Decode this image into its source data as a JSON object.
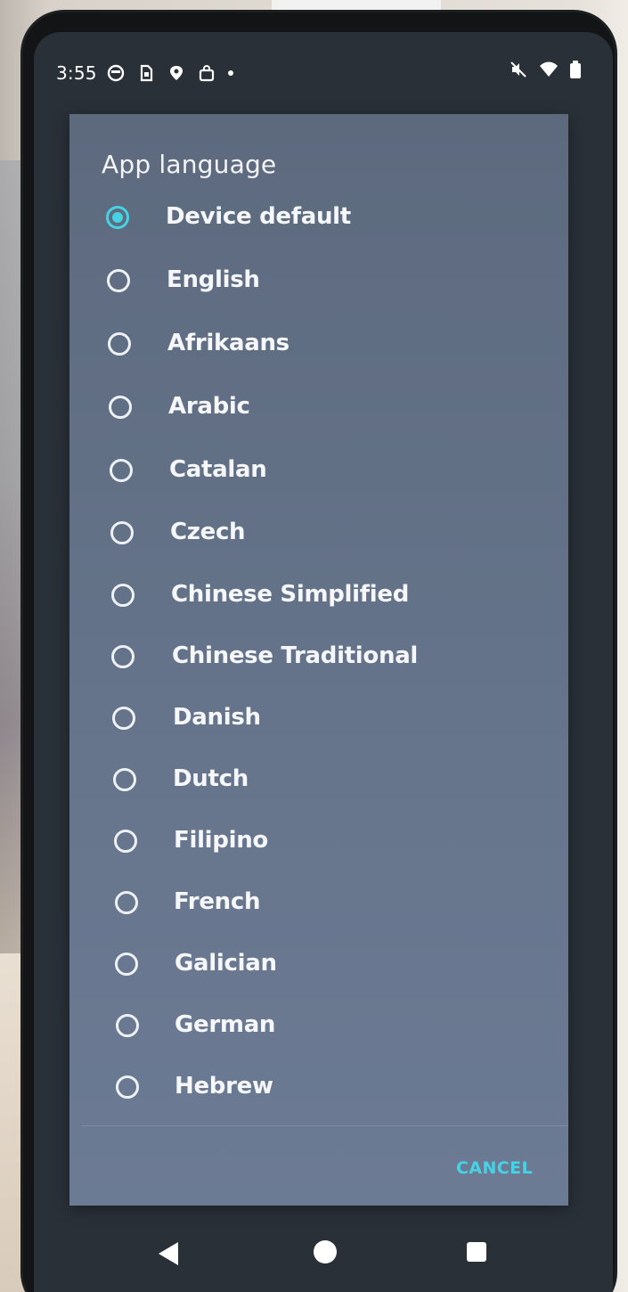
{
  "status_bar": {
    "time": "3:55",
    "left_icons": [
      "circle-face-icon",
      "sim-card-icon",
      "location-pin-icon",
      "shopping-bag-icon"
    ],
    "right_icons": [
      "mute-vibrate-icon",
      "wifi-icon",
      "battery-icon"
    ]
  },
  "dialog": {
    "title": "App language",
    "options": [
      {
        "label": "Device default",
        "selected": true
      },
      {
        "label": "English",
        "selected": false
      },
      {
        "label": "Afrikaans",
        "selected": false
      },
      {
        "label": "Arabic",
        "selected": false
      },
      {
        "label": "Catalan",
        "selected": false
      },
      {
        "label": "Czech",
        "selected": false
      },
      {
        "label": "Chinese Simplified",
        "selected": false
      },
      {
        "label": "Chinese Traditional",
        "selected": false
      },
      {
        "label": "Danish",
        "selected": false
      },
      {
        "label": "Dutch",
        "selected": false
      },
      {
        "label": "Filipino",
        "selected": false
      },
      {
        "label": "French",
        "selected": false
      },
      {
        "label": "Galician",
        "selected": false
      },
      {
        "label": "German",
        "selected": false
      },
      {
        "label": "Hebrew",
        "selected": false
      }
    ],
    "cancel_label": "CANCEL"
  },
  "colors": {
    "accent": "#46d3e6",
    "dialog_bg": "#65738a",
    "text": "#f5f7fa"
  },
  "nav_bar": {
    "buttons": [
      "back-icon",
      "home-icon",
      "recents-icon"
    ]
  }
}
